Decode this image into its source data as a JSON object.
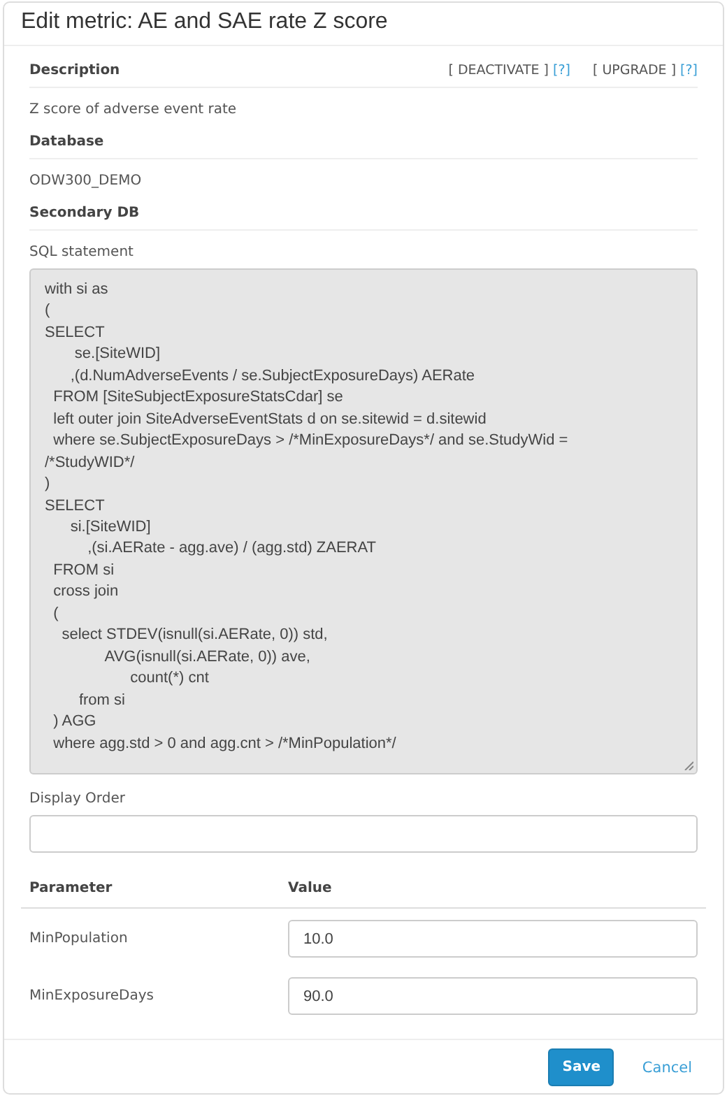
{
  "dialog": {
    "title": "Edit metric: AE and SAE rate Z score"
  },
  "description": {
    "label": "Description",
    "value": "Z score of adverse event rate",
    "actions": [
      {
        "label": "[ DEACTIVATE ]",
        "help": "[?]"
      },
      {
        "label": "[ UPGRADE ]",
        "help": "[?]"
      }
    ]
  },
  "database": {
    "label": "Database",
    "value": "ODW300_DEMO"
  },
  "secondary_db": {
    "label": "Secondary DB"
  },
  "sql": {
    "label": "SQL statement",
    "value": "with si as\n(\nSELECT\n       se.[SiteWID]\n      ,(d.NumAdverseEvents / se.SubjectExposureDays) AERate\n  FROM [SiteSubjectExposureStatsCdar] se\n  left outer join SiteAdverseEventStats d on se.sitewid = d.sitewid\n  where se.SubjectExposureDays > /*MinExposureDays*/ and se.StudyWid =\n/*StudyWID*/\n)\nSELECT\n      si.[SiteWID]\n          ,(si.AERate - agg.ave) / (agg.std) ZAERAT\n  FROM si\n  cross join\n  (\n    select STDEV(isnull(si.AERate, 0)) std,\n              AVG(isnull(si.AERate, 0)) ave,\n                    count(*) cnt\n        from si\n  ) AGG\n  where agg.std > 0 and agg.cnt > /*MinPopulation*/"
  },
  "display_order": {
    "label": "Display Order"
  },
  "parameters": {
    "columns": [
      "Parameter",
      "Value"
    ],
    "rows": [
      {
        "name": "MinPopulation",
        "value": "10.0"
      },
      {
        "name": "MinExposureDays",
        "value": "90.0"
      }
    ]
  },
  "buttons": {
    "save": "Save",
    "cancel": "Cancel"
  }
}
